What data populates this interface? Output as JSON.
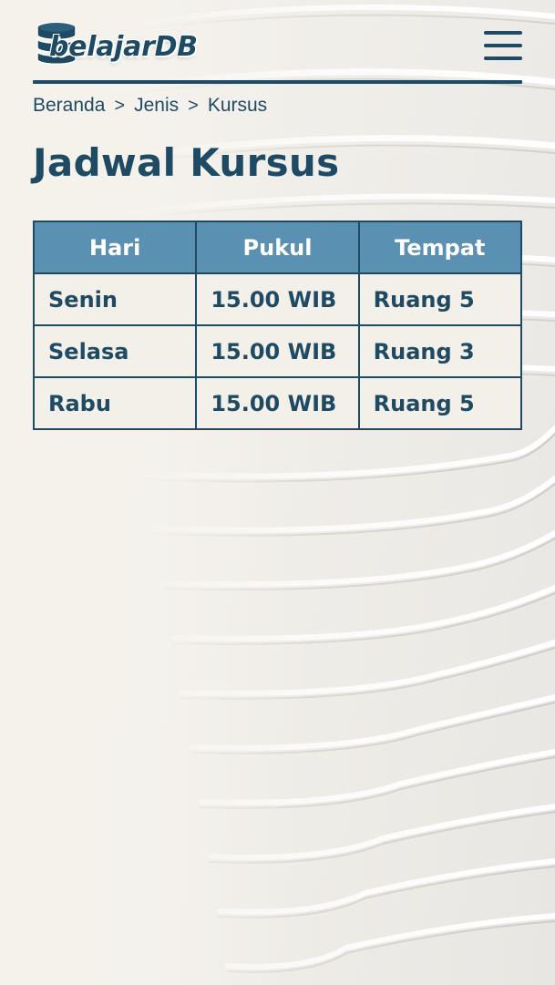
{
  "header": {
    "logo_text": "belajarDB",
    "menu_icon": "hamburger-menu-icon"
  },
  "breadcrumb": {
    "items": [
      "Beranda",
      "Jenis",
      "Kursus"
    ],
    "separator": ">"
  },
  "page": {
    "title": "Jadwal Kursus"
  },
  "table": {
    "headers": [
      "Hari",
      "Pukul",
      "Tempat"
    ],
    "rows": [
      [
        "Senin",
        "15.00 WIB",
        "Ruang 5"
      ],
      [
        "Selasa",
        "15.00 WIB",
        "Ruang 3"
      ],
      [
        "Rabu",
        "15.00 WIB",
        "Ruang 5"
      ]
    ]
  },
  "colors": {
    "primary": "#1f4a63",
    "table_header_bg": "#5a90b2",
    "background": "#f5f2ec"
  }
}
